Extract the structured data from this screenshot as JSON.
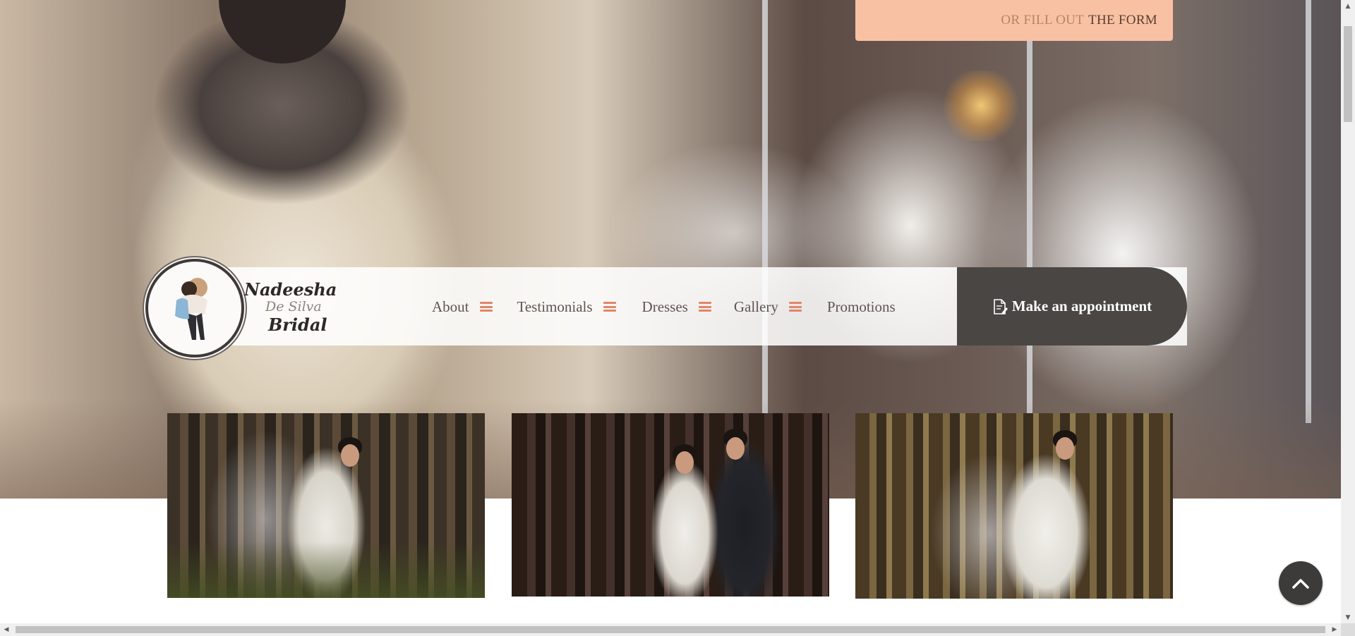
{
  "cta": {
    "muted_text": "OR FILL OUT",
    "strong_text": "THE FORM"
  },
  "brand": {
    "line1": "Nadeesha",
    "line2": "De Silva",
    "line3": "Bridal"
  },
  "nav": {
    "items": [
      {
        "label": "About",
        "icon": "menu-icon"
      },
      {
        "label": "Testimonials",
        "icon": "menu-icon"
      },
      {
        "label": "Dresses",
        "icon": "menu-icon"
      },
      {
        "label": "Gallery",
        "icon": "menu-icon"
      },
      {
        "label": "Promotions"
      }
    ],
    "appointment_label": "Make an appointment",
    "appointment_icon": "document-edit-icon"
  },
  "gallery": {
    "photos": [
      {
        "subject": "bride-with-veil-and-bouquet"
      },
      {
        "subject": "bride-and-groom-couple"
      },
      {
        "subject": "bride-portrait-with-bouquet"
      }
    ]
  },
  "controls": {
    "back_to_top_icon": "chevron-up-icon",
    "scroll_up_glyph": "▲",
    "scroll_down_glyph": "▼",
    "scroll_left_glyph": "◀",
    "scroll_right_glyph": "▶"
  },
  "colors": {
    "accent": "#e0866a",
    "cta_background": "#f9c1a3",
    "appointment_background": "#4a4644",
    "nav_text": "#5d5552"
  }
}
